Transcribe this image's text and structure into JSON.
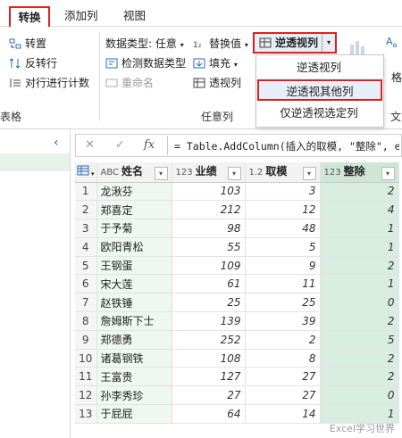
{
  "ribbon": {
    "tabs": [
      "转换",
      "添加列",
      "视图"
    ],
    "table_group": {
      "label": "表格"
    },
    "left_buttons": [
      "转置",
      "反转行",
      "对行进行计数"
    ],
    "any_column": {
      "data_type": "数据类型: 任意",
      "detect_type": "检测数据类型",
      "rename": "重命名",
      "replace_values": "替换值",
      "fill": "填充",
      "pivot": "透视列",
      "group_label": "任意列"
    },
    "unpivot_button": "逆透视列",
    "right_partial": [
      "格",
      "文"
    ]
  },
  "dropdown": {
    "items": [
      "逆透视列",
      "逆透视其他列",
      "仅逆透视选定列"
    ],
    "highlighted_index": 1
  },
  "formula_bar": {
    "cancel_icon": "✕",
    "confirm_icon": "✓",
    "fx": "fx",
    "text": "= Table.AddColumn(插入的取模, \"整除\", e"
  },
  "table": {
    "columns": [
      {
        "type": "ABC",
        "name": "姓名"
      },
      {
        "type": "123",
        "name": "业绩"
      },
      {
        "type": "1.2",
        "name": "取模"
      },
      {
        "type": "123",
        "name": "整除"
      }
    ],
    "rows": [
      [
        1,
        "龙湫芬",
        "103",
        "3",
        "2"
      ],
      [
        2,
        "郑喜定",
        "212",
        "12",
        "4"
      ],
      [
        3,
        "于予菊",
        "98",
        "48",
        "1"
      ],
      [
        4,
        "欧阳青松",
        "55",
        "5",
        "1"
      ],
      [
        5,
        "王钢蛋",
        "109",
        "9",
        "2"
      ],
      [
        6,
        "宋大莲",
        "61",
        "11",
        "1"
      ],
      [
        7,
        "赵铁锤",
        "25",
        "25",
        "0"
      ],
      [
        8,
        "詹姆斯下士",
        "139",
        "39",
        "2"
      ],
      [
        9,
        "郑德勇",
        "252",
        "2",
        "5"
      ],
      [
        10,
        "诸葛钢铁",
        "108",
        "8",
        "2"
      ],
      [
        11,
        "王富贵",
        "127",
        "27",
        "2"
      ],
      [
        12,
        "孙李秀珍",
        "27",
        "27",
        "0"
      ],
      [
        13,
        "于屁屁",
        "64",
        "14",
        "1"
      ]
    ]
  },
  "watermark": "Excel学习世界"
}
